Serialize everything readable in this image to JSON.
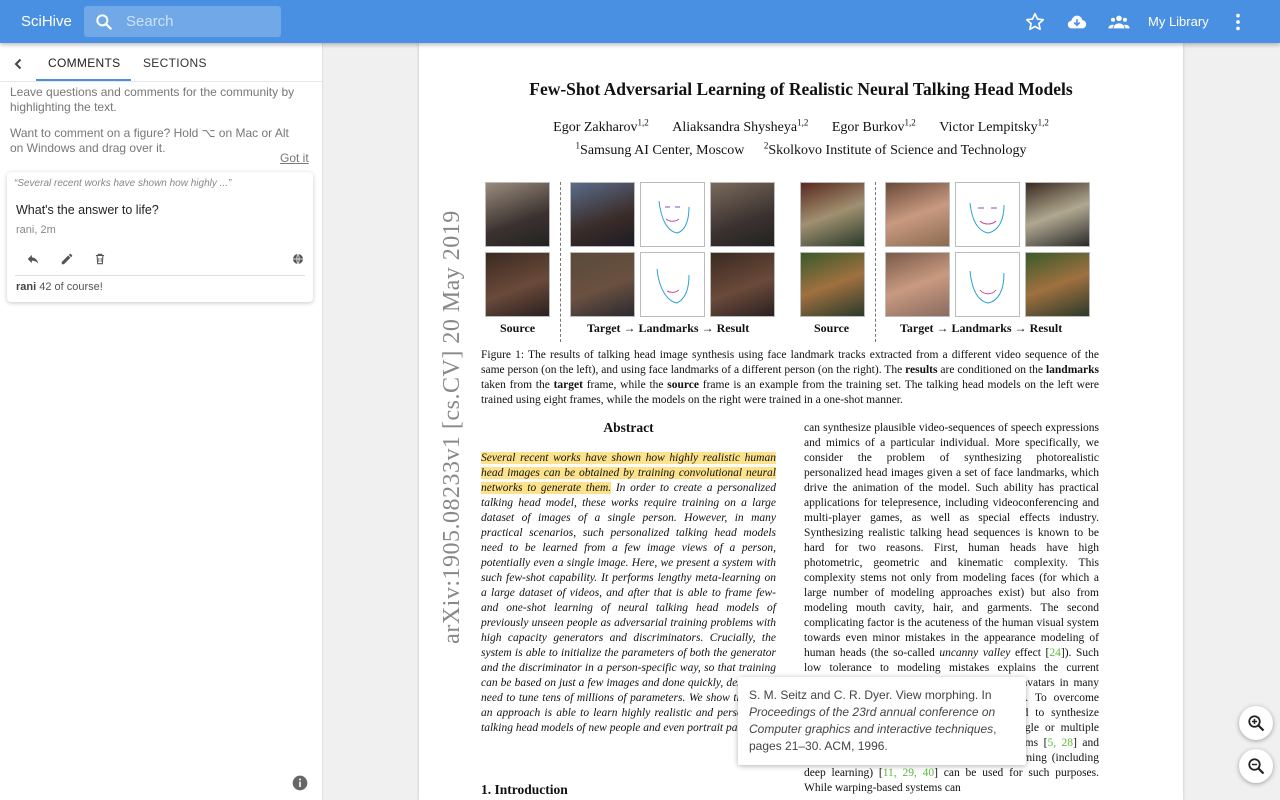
{
  "appbar": {
    "brand": "SciHive",
    "search_placeholder": "Search",
    "library_label": "My Library"
  },
  "sidebar": {
    "tabs": [
      "COMMENTS",
      "SECTIONS"
    ],
    "help_line1a": "Leave questions and comments for the community by",
    "help_line1b": "highlighting the text.",
    "help_line2a": "Want to comment on a figure? Hold ⌥ on Mac or Alt",
    "help_line2b": "on Windows and drag over it.",
    "got_it": "Got it",
    "comment": {
      "quote": "“Several recent works have shown how highly ...”",
      "question": "What's the answer to life?",
      "meta": "rani, 2m",
      "reply_user": "rani",
      "reply_text": "42 of course!"
    }
  },
  "paper": {
    "title": "Few-Shot Adversarial Learning of Realistic Neural Talking Head Models",
    "authors": [
      "Egor Zakharov",
      "Aliaksandra Shysheya",
      "Egor Burkov",
      "Victor Lempitsky"
    ],
    "author_sup": "1,2",
    "affil1_sup": "1",
    "affil1": "Samsung AI Center, Moscow",
    "affil2_sup": "2",
    "affil2": "Skolkovo Institute of Science and Technology",
    "arxiv_stamp": "arXiv:1905.08233v1  [cs.CV]  20 May 2019",
    "fig_labels_left": [
      "Source",
      "Target → Landmarks → Result"
    ],
    "fig_labels_right": [
      "Source",
      "Target → Landmarks → Result"
    ],
    "caption_part1": "Figure 1: The results of talking head image synthesis using face landmark tracks extracted from a different video sequence of the same person (on the left), and using face landmarks of a different person (on the right). The ",
    "caption_b1": "results",
    "caption_part2": " are conditioned on the ",
    "caption_b2": "landmarks",
    "caption_part3": " taken from the ",
    "caption_b3": "target",
    "caption_part4": " frame, while the ",
    "caption_b4": "source",
    "caption_part5": " frame is an example from the training set. The talking head models on the left were trained using eight frames, while the models on the right were trained in a one-shot manner.",
    "abstract_title": "Abstract",
    "abstract_highlight": "Several recent works have shown how highly realistic human head images can be obtained by training convolutional neural networks to generate them.",
    "abstract_rest": " In order to create a personalized talking head model, these works require training on a large dataset of images of a single person. However, in many practical scenarios, such personalized talking head models need to be learned from a few image views of a person, potentially even a single image. Here, we present a system with such few-shot capability. It performs lengthy meta-learning on a large dataset of videos, and after that is able to frame few- and one-shot learning of neural talking head models of previously unseen people as adversarial training problems with high capacity generators and discriminators. Crucially, the system is able to initialize the parameters of both the generator and the discriminator in a person-specific way, so that training can be based on just a few images and done quickly, despite the need to tune tens of millions of parameters. We show that such an approach is able to learn highly realistic and personalized talking head models of new people and even portrait paintings.",
    "col2_part1": "can synthesize plausible video-sequences of speech expressions and mimics of a particular individual. More specifically, we consider the problem of synthesizing photorealistic personalized head images given a set of face landmarks, which drive the animation of the model. Such ability has practical applications for telepresence, including videoconferencing and multi-player games, as well as special effects industry. Synthesizing realistic talking head sequences is known to be hard for two reasons. First, human heads have high photometric, geometric and kinematic complexity. This complexity stems not only from modeling faces (for which a large number of modeling approaches exist) but also from modeling mouth cavity, hair, and garments. The second complicating factor is the acuteness of the human visual system towards even minor mistakes in the appearance modeling of human heads (the so-called ",
    "col2_italic": "uncanny valley",
    "col2_part2": " effect [",
    "col2_cite1": "24",
    "col2_part3": "]). Such low tolerance to modeling mistakes explains the current prevalence of non-photorealistic cartoon-like avatars in many practically-deployed teleconferencing systems. To overcome the challenges, several works have proposed to synthesize articulated head sequences by warping a single or multiple static frames. Both classical warping algorithms [",
    "col2_cite2": "5, 28",
    "col2_part4": "] and warping fields synthesized using machine learning (including deep learning) [",
    "col2_cite3": "11, 29, 40",
    "col2_part5": "] can be used for such purposes. While warping-based systems can",
    "intro": "1. Introduction"
  },
  "tooltip": {
    "line1": "S. M. Seitz and C. R. Dyer. View morphing. In",
    "line2": "Proceedings of the 23rd annual conference on Computer graphics and interactive techniques",
    "line3": "pages 21–30. ACM, 1996."
  },
  "icons": {
    "search": "search-icon",
    "star": "star-icon",
    "cloud": "cloud-download-icon",
    "people": "people-icon",
    "more": "more-vert-icon",
    "back": "chevron-left-icon",
    "reply": "reply-icon",
    "edit": "pencil-icon",
    "delete": "trash-icon",
    "globe": "globe-icon",
    "info": "info-icon",
    "zoom_in": "zoom-in-icon",
    "zoom_out": "zoom-out-icon"
  },
  "colors": {
    "appbar": "#4a90e2",
    "highlight": "#fce28a",
    "citation": "#5cbd3a"
  }
}
